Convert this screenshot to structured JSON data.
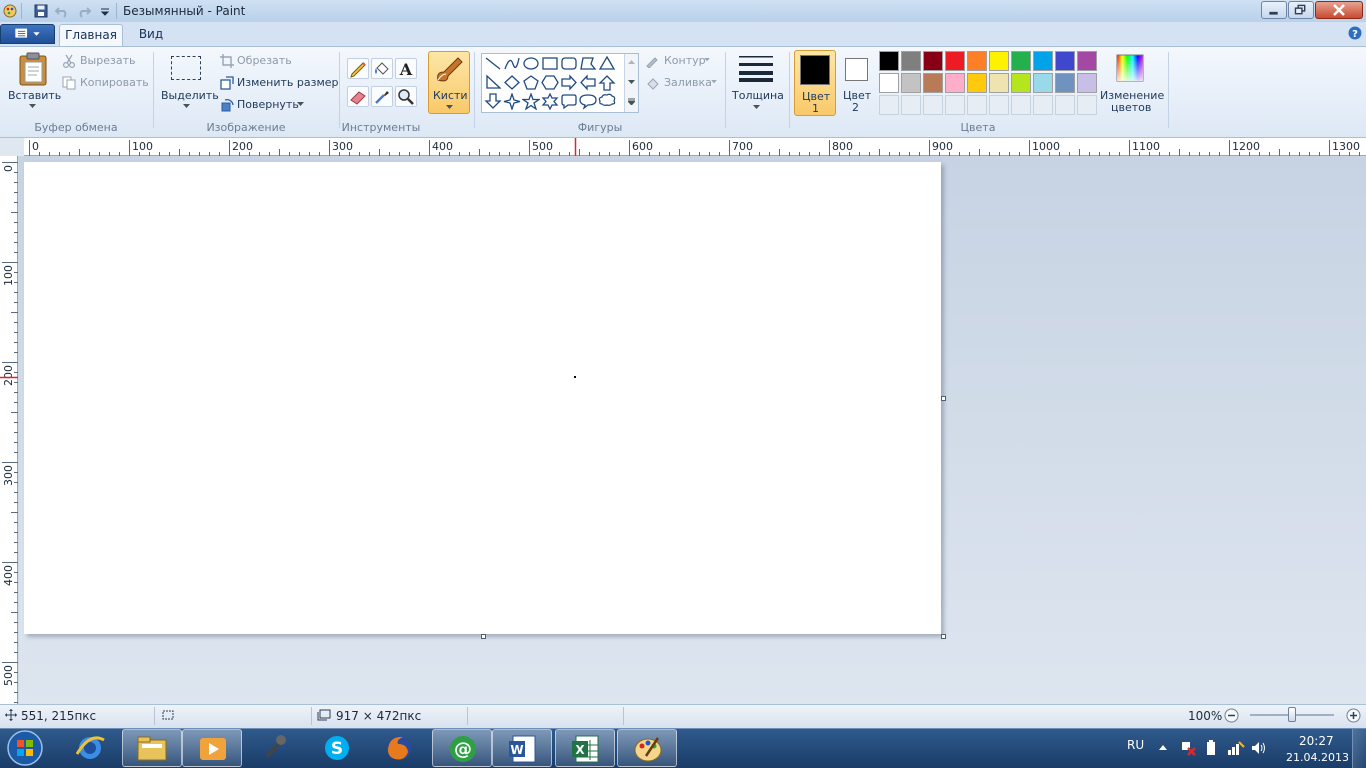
{
  "window": {
    "title": "Безымянный - Paint"
  },
  "tabs": [
    {
      "label": "Главная"
    },
    {
      "label": "Вид"
    }
  ],
  "clipboard": {
    "paste_label": "Вставить",
    "cut_label": "Вырезать",
    "copy_label": "Копировать",
    "group_label": "Буфер обмена"
  },
  "image": {
    "select_label": "Выделить",
    "crop_label": "Обрезать",
    "resize_label": "Изменить размер",
    "rotate_label": "Повернуть",
    "group_label": "Изображение"
  },
  "tools": {
    "group_label": "Инструменты",
    "brushes_label": "Кисти",
    "icons": [
      "pencil-icon",
      "fill-icon",
      "text-icon",
      "eraser-icon",
      "color-picker-icon",
      "magnifier-icon"
    ]
  },
  "shapes": {
    "group_label": "Фигуры",
    "outline_label": "Контур",
    "fill_label": "Заливка",
    "items": [
      "line",
      "curve",
      "oval",
      "rectangle",
      "rounded-rectangle",
      "polygon",
      "triangle",
      "right-triangle",
      "diamond",
      "pentagon",
      "hexagon",
      "right-arrow",
      "left-arrow",
      "up-arrow",
      "down-arrow",
      "four-point-star",
      "five-point-star",
      "six-point-star",
      "rounded-callout",
      "oval-callout",
      "cloud-callout"
    ]
  },
  "size": {
    "label": "Толщина"
  },
  "colors": {
    "color1_label": "Цвет",
    "color1_num": "1",
    "color2_label": "Цвет",
    "color2_num": "2",
    "color1": "#000000",
    "color2": "#ffffff",
    "edit_label_1": "Изменение",
    "edit_label_2": "цветов",
    "group_label": "Цвета",
    "palette_row1": [
      "#000000",
      "#7f7f7f",
      "#880015",
      "#ed1c24",
      "#ff7f27",
      "#fff200",
      "#22b14c",
      "#00a2e8",
      "#3f48cc",
      "#a349a4"
    ],
    "palette_row2": [
      "#ffffff",
      "#c3c3c3",
      "#b97a57",
      "#ffaec9",
      "#ffc90e",
      "#efe4b0",
      "#b5e61d",
      "#99d9ea",
      "#7092be",
      "#c8bfe7"
    ],
    "accent": "#f9c96a"
  },
  "ruler": {
    "h_labels": [
      "0",
      "100",
      "200",
      "300",
      "400",
      "500",
      "600",
      "700",
      "800",
      "900",
      "1000",
      "1100",
      "1200",
      "1300"
    ],
    "v_labels": [
      "0",
      "100",
      "200",
      "300",
      "400",
      "500"
    ]
  },
  "status": {
    "cursor_pos": "551, 215пкс",
    "image_size": "917 × 472пкс",
    "zoom": "100%"
  },
  "taskbar": {
    "apps": [
      "start-orb-icon",
      "internet-explorer-icon",
      "explorer-icon",
      "media-player-icon",
      "microphone-icon",
      "skype-icon",
      "firefox-icon",
      "mail-agent-icon",
      "word-icon",
      "excel-icon",
      "paint-icon"
    ],
    "lang": "RU",
    "time": "20:27",
    "date": "21.04.2013"
  }
}
